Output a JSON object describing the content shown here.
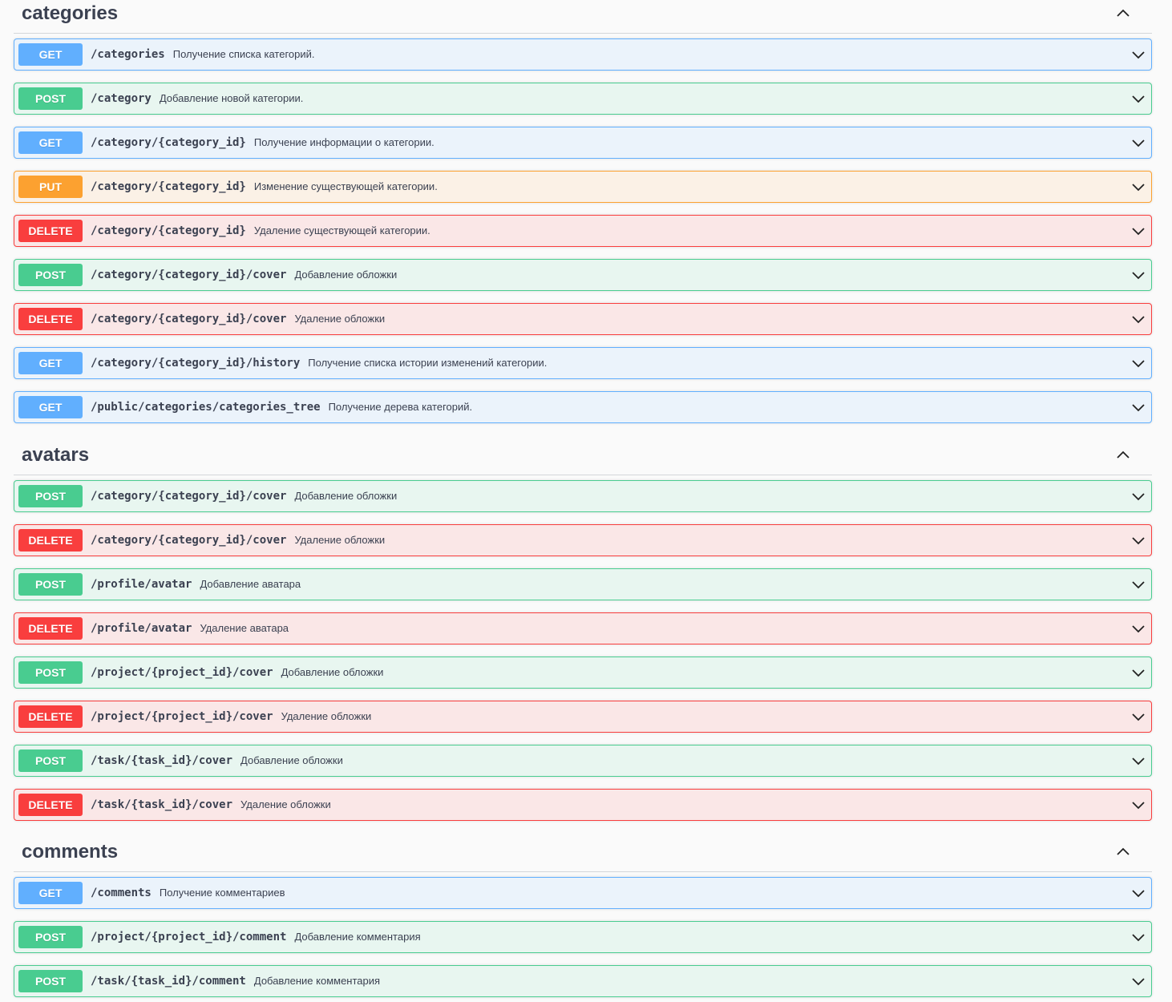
{
  "sections": [
    {
      "title": "categories",
      "operations": [
        {
          "method": "GET",
          "path": "/categories",
          "summary": "Получение списка категорий."
        },
        {
          "method": "POST",
          "path": "/category",
          "summary": "Добавление новой категории."
        },
        {
          "method": "GET",
          "path": "/category/{category_id}",
          "summary": "Получение информации о категории."
        },
        {
          "method": "PUT",
          "path": "/category/{category_id}",
          "summary": "Изменение существующей категории."
        },
        {
          "method": "DELETE",
          "path": "/category/{category_id}",
          "summary": "Удаление существующей категории."
        },
        {
          "method": "POST",
          "path": "/category/{category_id}/cover",
          "summary": "Добавление обложки"
        },
        {
          "method": "DELETE",
          "path": "/category/{category_id}/cover",
          "summary": "Удаление обложки"
        },
        {
          "method": "GET",
          "path": "/category/{category_id}/history",
          "summary": "Получение списка истории изменений категории."
        },
        {
          "method": "GET",
          "path": "/public/categories/categories_tree",
          "summary": "Получение дерева категорий."
        }
      ]
    },
    {
      "title": "avatars",
      "operations": [
        {
          "method": "POST",
          "path": "/category/{category_id}/cover",
          "summary": "Добавление обложки"
        },
        {
          "method": "DELETE",
          "path": "/category/{category_id}/cover",
          "summary": "Удаление обложки"
        },
        {
          "method": "POST",
          "path": "/profile/avatar",
          "summary": "Добавление аватара"
        },
        {
          "method": "DELETE",
          "path": "/profile/avatar",
          "summary": "Удаление аватара"
        },
        {
          "method": "POST",
          "path": "/project/{project_id}/cover",
          "summary": "Добавление обложки"
        },
        {
          "method": "DELETE",
          "path": "/project/{project_id}/cover",
          "summary": "Удаление обложки"
        },
        {
          "method": "POST",
          "path": "/task/{task_id}/cover",
          "summary": "Добавление обложки"
        },
        {
          "method": "DELETE",
          "path": "/task/{task_id}/cover",
          "summary": "Удаление обложки"
        }
      ]
    },
    {
      "title": "comments",
      "operations": [
        {
          "method": "GET",
          "path": "/comments",
          "summary": "Получение комментариев"
        },
        {
          "method": "POST",
          "path": "/project/{project_id}/comment",
          "summary": "Добавление комментария"
        },
        {
          "method": "POST",
          "path": "/task/{task_id}/comment",
          "summary": "Добавление комментария"
        }
      ]
    }
  ],
  "icons": {
    "section_toggle": "chevron-up-icon",
    "operation_toggle": "chevron-down-icon"
  },
  "colors": {
    "GET": "#61affe",
    "POST": "#49cc90",
    "PUT": "#fca130",
    "DELETE": "#f93e3e"
  }
}
